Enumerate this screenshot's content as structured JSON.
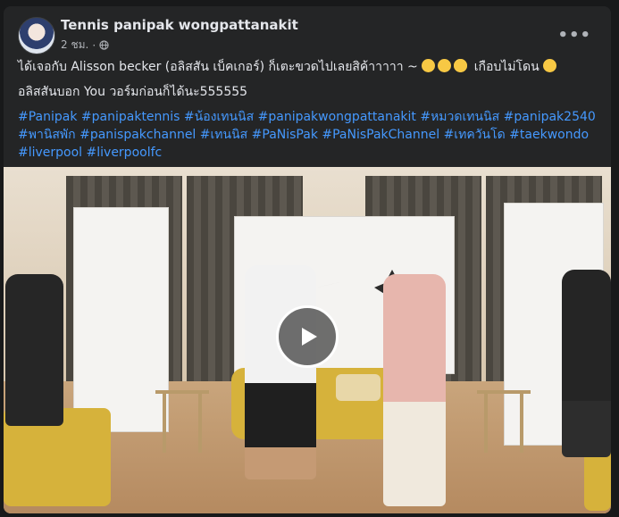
{
  "post": {
    "author": "Tennis panipak wongpattanakit",
    "time": "2 ชม.",
    "dot": "·",
    "more_label": "•••",
    "line1_text": "ได้เจอกับ Alisson becker (อลิสสัน เบ็คเกอร์) ก็เตะขวดไปเลยสิค้าาาาา ~",
    "line1_suffix": "เกือบไม่โดน",
    "line2_text": "อลิสสันบอก You วอร์มก่อนก็ได้นะ555555",
    "hashtags": "#Panipak #panipaktennis #น้องเทนนิส #panipakwongpattanakit #หมวดเทนนิส #panipak2540 #พานิสพัก #panispakchannel #เทนนิส #PaNisPak #PaNisPakChannel #เทควันโด #taekwondo #liverpool #liverpoolfc"
  },
  "video": {
    "play_label": "Play video"
  },
  "colors": {
    "link": "#4599ff",
    "card": "#242526",
    "page": "#18191a"
  },
  "icons": [
    "globe-icon",
    "more-icon",
    "play-icon",
    "emoji-icon"
  ]
}
